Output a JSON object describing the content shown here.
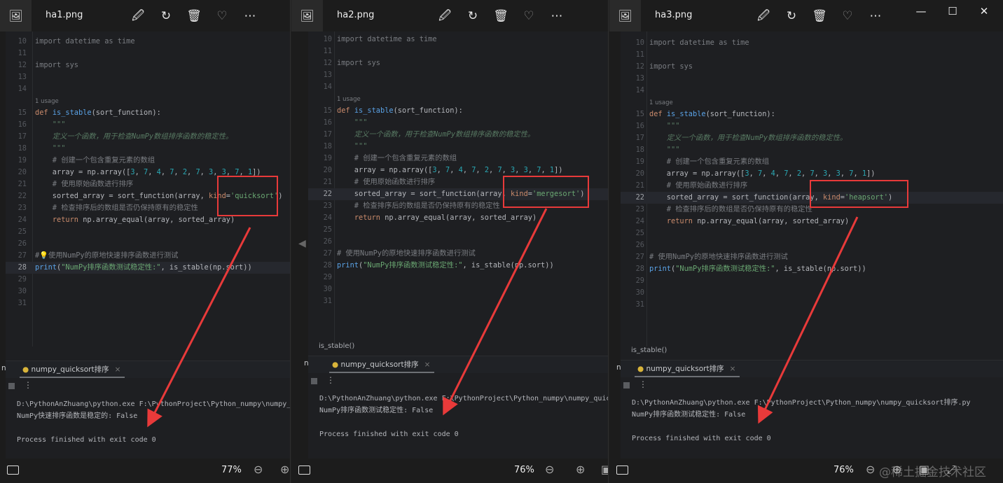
{
  "colors": {
    "annotation": "#e83a3a",
    "accent": "#3b78c9"
  },
  "toolbar_icons": [
    "edit-image-icon",
    "rotate-icon",
    "delete-icon",
    "favorite-heart-icon",
    "more-options-icon"
  ],
  "window_controls": {
    "minimize": "—",
    "maximize": "☐",
    "close": "✕"
  },
  "watermark": "@稀土掘金技术社区",
  "windows": [
    {
      "title": "ha1.png",
      "zoom": "77%",
      "current_line": "28",
      "breadcrumb": "",
      "usage": "1 usage",
      "code": [
        {
          "n": "10",
          "seg": [
            [
              "import datetime as time",
              "cm"
            ]
          ]
        },
        {
          "n": "11",
          "seg": []
        },
        {
          "n": "12",
          "seg": [
            [
              "import sys",
              "cm"
            ]
          ]
        },
        {
          "n": "13",
          "seg": []
        },
        {
          "n": "14",
          "seg": []
        },
        {
          "n": "",
          "usage": true,
          "seg": []
        },
        {
          "n": "15",
          "seg": [
            [
              "def ",
              "kw"
            ],
            [
              "is_stable",
              "fn"
            ],
            [
              "(sort_function):",
              "pl"
            ]
          ]
        },
        {
          "n": "16",
          "seg": [
            [
              "    \"\"\"",
              "doc"
            ]
          ]
        },
        {
          "n": "17",
          "seg": [
            [
              "    定义一个函数，用于检查NumPy数组排序函数的稳定性。",
              "doc"
            ]
          ]
        },
        {
          "n": "18",
          "seg": [
            [
              "    \"\"\"",
              "doc"
            ]
          ]
        },
        {
          "n": "19",
          "seg": [
            [
              "    # 创建一个包含重复元素的数组",
              "cm"
            ]
          ]
        },
        {
          "n": "20",
          "seg": [
            [
              "    array = np.array([",
              "pl"
            ],
            [
              "3",
              "num"
            ],
            [
              ", ",
              "pl"
            ],
            [
              "7",
              "num"
            ],
            [
              ", ",
              "pl"
            ],
            [
              "4",
              "num"
            ],
            [
              ", ",
              "pl"
            ],
            [
              "7",
              "num"
            ],
            [
              ", ",
              "pl"
            ],
            [
              "2",
              "num"
            ],
            [
              ", ",
              "pl"
            ],
            [
              "7",
              "num"
            ],
            [
              ", ",
              "pl"
            ],
            [
              "3",
              "num"
            ],
            [
              ", ",
              "pl"
            ],
            [
              "3",
              "num"
            ],
            [
              ", ",
              "pl"
            ],
            [
              "7",
              "num"
            ],
            [
              ", ",
              "pl"
            ],
            [
              "1",
              "num"
            ],
            [
              "])",
              "pl"
            ]
          ]
        },
        {
          "n": "21",
          "seg": [
            [
              "    # 使用原始函数进行排序",
              "cm"
            ]
          ]
        },
        {
          "n": "22",
          "seg": [
            [
              "    sorted_array = sort_function(array, ",
              "pl"
            ],
            [
              "kind",
              "kw"
            ],
            [
              "=",
              "pl"
            ],
            [
              "'quicksort'",
              "str"
            ],
            [
              ")",
              "pl"
            ]
          ]
        },
        {
          "n": "23",
          "seg": [
            [
              "    # 检查排序后的数组是否仍保持原有的稳定性",
              "cm"
            ]
          ]
        },
        {
          "n": "24",
          "seg": [
            [
              "    ",
              "pl"
            ],
            [
              "return ",
              "kw"
            ],
            [
              "np.array_equal(array, sorted_array)",
              "pl"
            ]
          ]
        },
        {
          "n": "25",
          "seg": []
        },
        {
          "n": "26",
          "seg": []
        },
        {
          "n": "27",
          "seg": [
            [
              "#💡使用NumPy的原地快速排序函数进行测试",
              "cm"
            ]
          ]
        },
        {
          "n": "28",
          "seg": [
            [
              "print",
              "fn"
            ],
            [
              "(",
              "pl"
            ],
            [
              "\"NumPy排序函数测试稳定性:\"",
              "str"
            ],
            [
              ", is_stable(np.sort))",
              "pl"
            ]
          ]
        },
        {
          "n": "29",
          "seg": []
        },
        {
          "n": "30",
          "seg": []
        },
        {
          "n": "31",
          "seg": []
        }
      ],
      "run_tab": "numpy_quicksort排序",
      "run_tab_prefix": "n",
      "output": [
        "D:\\PythonAnZhuang\\python.exe F:\\PythonProject\\Python_numpy\\numpy_quicksort排序.py",
        "NumPy快速排序函数是稳定的: False",
        "",
        "Process finished with exit code 0"
      ]
    },
    {
      "title": "ha2.png",
      "zoom": "76%",
      "current_line": "22",
      "breadcrumb": "is_stable()",
      "usage": "1 usage",
      "code": [
        {
          "n": "10",
          "seg": [
            [
              "import datetime as time",
              "cm"
            ]
          ]
        },
        {
          "n": "11",
          "seg": []
        },
        {
          "n": "12",
          "seg": [
            [
              "import sys",
              "cm"
            ]
          ]
        },
        {
          "n": "13",
          "seg": []
        },
        {
          "n": "14",
          "seg": []
        },
        {
          "n": "",
          "usage": true,
          "seg": []
        },
        {
          "n": "15",
          "seg": [
            [
              "def ",
              "kw"
            ],
            [
              "is_stable",
              "fn"
            ],
            [
              "(sort_function):",
              "pl"
            ]
          ]
        },
        {
          "n": "16",
          "seg": [
            [
              "    \"\"\"",
              "doc"
            ]
          ]
        },
        {
          "n": "17",
          "seg": [
            [
              "    定义一个函数，用于检查NumPy数组排序函数的稳定性。",
              "doc"
            ]
          ]
        },
        {
          "n": "18",
          "seg": [
            [
              "    \"\"\"",
              "doc"
            ]
          ]
        },
        {
          "n": "19",
          "seg": [
            [
              "    # 创建一个包含重复元素的数组",
              "cm"
            ]
          ]
        },
        {
          "n": "20",
          "seg": [
            [
              "    array = np.array([",
              "pl"
            ],
            [
              "3",
              "num"
            ],
            [
              ", ",
              "pl"
            ],
            [
              "7",
              "num"
            ],
            [
              ", ",
              "pl"
            ],
            [
              "4",
              "num"
            ],
            [
              ", ",
              "pl"
            ],
            [
              "7",
              "num"
            ],
            [
              ", ",
              "pl"
            ],
            [
              "2",
              "num"
            ],
            [
              ", ",
              "pl"
            ],
            [
              "7",
              "num"
            ],
            [
              ", ",
              "pl"
            ],
            [
              "3",
              "num"
            ],
            [
              ", ",
              "pl"
            ],
            [
              "3",
              "num"
            ],
            [
              ", ",
              "pl"
            ],
            [
              "7",
              "num"
            ],
            [
              ", ",
              "pl"
            ],
            [
              "1",
              "num"
            ],
            [
              "])",
              "pl"
            ]
          ]
        },
        {
          "n": "21",
          "seg": [
            [
              "    # 使用原始函数进行排序",
              "cm"
            ]
          ]
        },
        {
          "n": "22",
          "seg": [
            [
              "    sorted_array = sort_function(array, ",
              "pl"
            ],
            [
              "kind",
              "kw"
            ],
            [
              "=",
              "pl"
            ],
            [
              "'mergesort'",
              "str"
            ],
            [
              ")",
              "pl"
            ]
          ]
        },
        {
          "n": "23",
          "seg": [
            [
              "    # 检查排序后的数组是否仍保持原有的稳定性",
              "cm"
            ]
          ]
        },
        {
          "n": "24",
          "seg": [
            [
              "    ",
              "pl"
            ],
            [
              "return ",
              "kw"
            ],
            [
              "np.array_equal(array, sorted_array)",
              "pl"
            ]
          ]
        },
        {
          "n": "25",
          "seg": []
        },
        {
          "n": "26",
          "seg": []
        },
        {
          "n": "27",
          "seg": [
            [
              "# 使用NumPy的原地快速排序函数进行测试",
              "cm"
            ]
          ]
        },
        {
          "n": "28",
          "seg": [
            [
              "print",
              "fn"
            ],
            [
              "(",
              "pl"
            ],
            [
              "\"NumPy排序函数测试稳定性:\"",
              "str"
            ],
            [
              ", is_stable(np.sort))",
              "pl"
            ]
          ]
        },
        {
          "n": "29",
          "seg": []
        },
        {
          "n": "30",
          "seg": []
        },
        {
          "n": "31",
          "seg": []
        }
      ],
      "run_tab": "numpy_quicksort排序",
      "run_tab_prefix": "n",
      "output": [
        "D:\\PythonAnZhuang\\python.exe F:\\PythonProject\\Python_numpy\\numpy_quicksort排序.py",
        "NumPy排序函数测试稳定性: False",
        "",
        "Process finished with exit code 0"
      ]
    },
    {
      "title": "ha3.png",
      "zoom": "76%",
      "current_line": "22",
      "breadcrumb": "is_stable()",
      "usage": "1 usage",
      "code": [
        {
          "n": "10",
          "seg": [
            [
              "import datetime as time",
              "cm"
            ]
          ]
        },
        {
          "n": "11",
          "seg": []
        },
        {
          "n": "12",
          "seg": [
            [
              "import sys",
              "cm"
            ]
          ]
        },
        {
          "n": "13",
          "seg": []
        },
        {
          "n": "14",
          "seg": []
        },
        {
          "n": "",
          "usage": true,
          "seg": []
        },
        {
          "n": "15",
          "seg": [
            [
              "def ",
              "kw"
            ],
            [
              "is_stable",
              "fn"
            ],
            [
              "(sort_function):",
              "pl"
            ]
          ]
        },
        {
          "n": "16",
          "seg": [
            [
              "    \"\"\"",
              "doc"
            ]
          ]
        },
        {
          "n": "17",
          "seg": [
            [
              "    定义一个函数，用于检查NumPy数组排序函数的稳定性。",
              "doc"
            ]
          ]
        },
        {
          "n": "18",
          "seg": [
            [
              "    \"\"\"",
              "doc"
            ]
          ]
        },
        {
          "n": "19",
          "seg": [
            [
              "    # 创建一个包含重复元素的数组",
              "cm"
            ]
          ]
        },
        {
          "n": "20",
          "seg": [
            [
              "    array = np.array([",
              "pl"
            ],
            [
              "3",
              "num"
            ],
            [
              ", ",
              "pl"
            ],
            [
              "7",
              "num"
            ],
            [
              ", ",
              "pl"
            ],
            [
              "4",
              "num"
            ],
            [
              ", ",
              "pl"
            ],
            [
              "7",
              "num"
            ],
            [
              ", ",
              "pl"
            ],
            [
              "2",
              "num"
            ],
            [
              ", ",
              "pl"
            ],
            [
              "7",
              "num"
            ],
            [
              ", ",
              "pl"
            ],
            [
              "3",
              "num"
            ],
            [
              ", ",
              "pl"
            ],
            [
              "3",
              "num"
            ],
            [
              ", ",
              "pl"
            ],
            [
              "7",
              "num"
            ],
            [
              ", ",
              "pl"
            ],
            [
              "1",
              "num"
            ],
            [
              "])",
              "pl"
            ]
          ]
        },
        {
          "n": "21",
          "seg": [
            [
              "    # 使用原始函数进行排序",
              "cm"
            ]
          ]
        },
        {
          "n": "22",
          "seg": [
            [
              "    sorted_array = sort_function(array, ",
              "pl"
            ],
            [
              "kind",
              "kw"
            ],
            [
              "=",
              "pl"
            ],
            [
              "'heapsort'",
              "str"
            ],
            [
              ")",
              "pl"
            ]
          ]
        },
        {
          "n": "23",
          "seg": [
            [
              "    # 检查排序后的数组是否仍保持原有的稳定性",
              "cm"
            ]
          ]
        },
        {
          "n": "24",
          "seg": [
            [
              "    ",
              "pl"
            ],
            [
              "return ",
              "kw"
            ],
            [
              "np.array_equal(array, sorted_array)",
              "pl"
            ]
          ]
        },
        {
          "n": "25",
          "seg": []
        },
        {
          "n": "26",
          "seg": []
        },
        {
          "n": "27",
          "seg": [
            [
              "# 使用NumPy的原地快速排序函数进行测试",
              "cm"
            ]
          ]
        },
        {
          "n": "28",
          "seg": [
            [
              "print",
              "fn"
            ],
            [
              "(",
              "pl"
            ],
            [
              "\"NumPy排序函数测试稳定性:\"",
              "str"
            ],
            [
              ", is_stable(np.sort))",
              "pl"
            ]
          ]
        },
        {
          "n": "29",
          "seg": []
        },
        {
          "n": "30",
          "seg": []
        },
        {
          "n": "31",
          "seg": []
        }
      ],
      "run_tab": "numpy_quicksort排序",
      "run_tab_prefix": "n",
      "output": [
        "D:\\PythonAnZhuang\\python.exe F:\\PythonProject\\Python_numpy\\numpy_quicksort排序.py",
        "NumPy排序函数测试稳定性: False",
        "",
        "Process finished with exit code 0"
      ]
    }
  ]
}
